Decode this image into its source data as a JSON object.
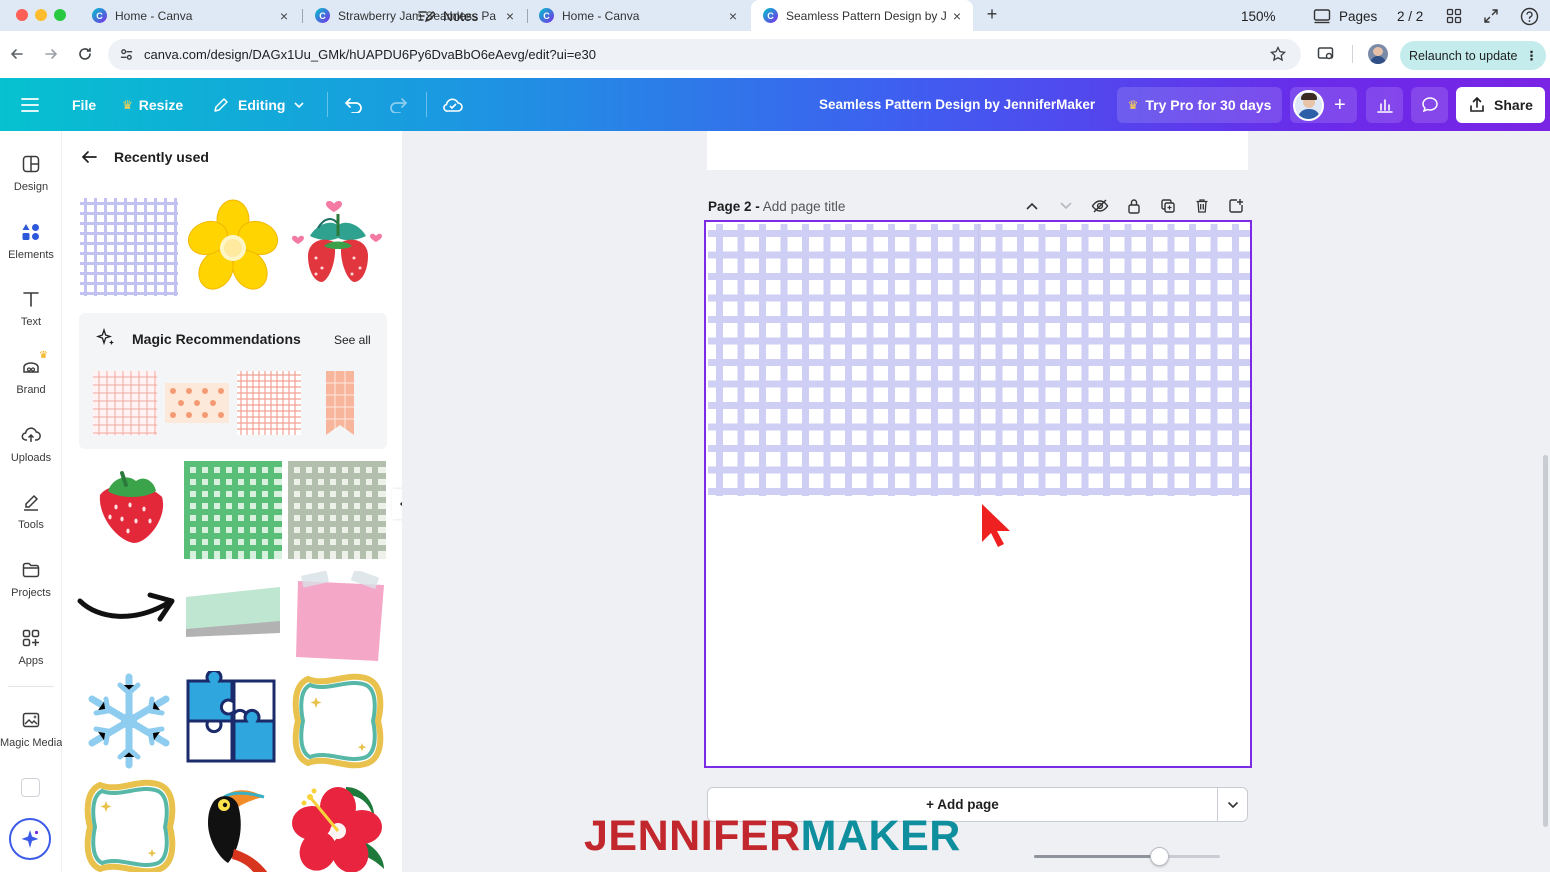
{
  "browser": {
    "tabs": [
      {
        "title": "Home - Canva",
        "active": false
      },
      {
        "title": "Strawberry Jam Seamless Pa",
        "active": false
      },
      {
        "title": "Home - Canva",
        "active": false
      },
      {
        "title": "Seamless Pattern Design by J",
        "active": true
      }
    ],
    "url": "canva.com/design/DAGx1Uu_GMk/hUAPDU6Py6DvaBbO6eAevg/edit?ui=e30",
    "relaunch_label": "Relaunch to update"
  },
  "topbar": {
    "file": "File",
    "resize": "Resize",
    "editing": "Editing",
    "design_title": "Seamless Pattern Design by JenniferMaker",
    "try_pro": "Try Pro for 30 days",
    "share": "Share"
  },
  "rail": {
    "items": [
      {
        "label": "Design",
        "icon": "design-icon"
      },
      {
        "label": "Elements",
        "icon": "elements-icon"
      },
      {
        "label": "Text",
        "icon": "text-icon"
      },
      {
        "label": "Brand",
        "icon": "brand-icon"
      },
      {
        "label": "Uploads",
        "icon": "uploads-icon"
      },
      {
        "label": "Tools",
        "icon": "tools-icon"
      },
      {
        "label": "Projects",
        "icon": "projects-icon"
      },
      {
        "label": "Apps",
        "icon": "apps-icon"
      },
      {
        "label": "Magic Media",
        "icon": "magic-media-icon"
      }
    ]
  },
  "panel": {
    "heading": "Recently used",
    "magic_title": "Magic Recommendations",
    "see_all": "See all"
  },
  "canvas": {
    "page_number": "Page 2 -",
    "page_title_placeholder": "Add page title",
    "add_page": "+ Add page",
    "pattern_color": "#8f8fe8"
  },
  "bottombar": {
    "notes": "Notes",
    "zoom": "150%",
    "zoom_fraction": 0.68,
    "pages": "Pages",
    "page_count": "2 / 2"
  },
  "watermark": {
    "part1": "JENNIFER",
    "part2": "MAKER"
  },
  "colors": {
    "accent": "#7d2ae8",
    "brand_teal": "#00c4cc",
    "relaunch_bg": "#c4ecec"
  }
}
